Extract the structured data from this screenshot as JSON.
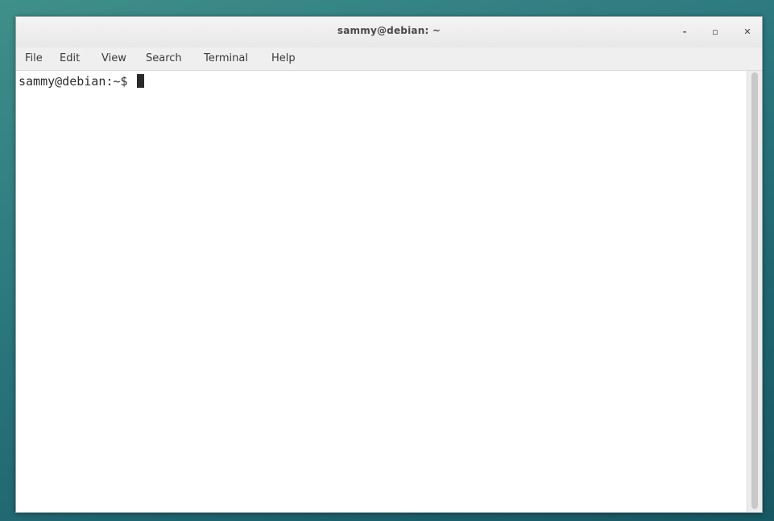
{
  "window": {
    "title": "sammy@debian: ~",
    "controls": {
      "minimize": "-",
      "maximize": "▫",
      "close": "✕"
    }
  },
  "menu": {
    "items": [
      "File",
      "Edit",
      "View",
      "Search",
      "Terminal",
      "Help"
    ]
  },
  "terminal": {
    "prompt": "sammy@debian:~$ "
  },
  "colors": {
    "desktop": "#2d7a80",
    "window_bg": "#ffffff",
    "titlebar": "#eeeeee",
    "text": "#2e2e2e"
  },
  "icons": {
    "minimize": "minimize-icon",
    "maximize": "maximize-icon",
    "close": "close-icon"
  }
}
